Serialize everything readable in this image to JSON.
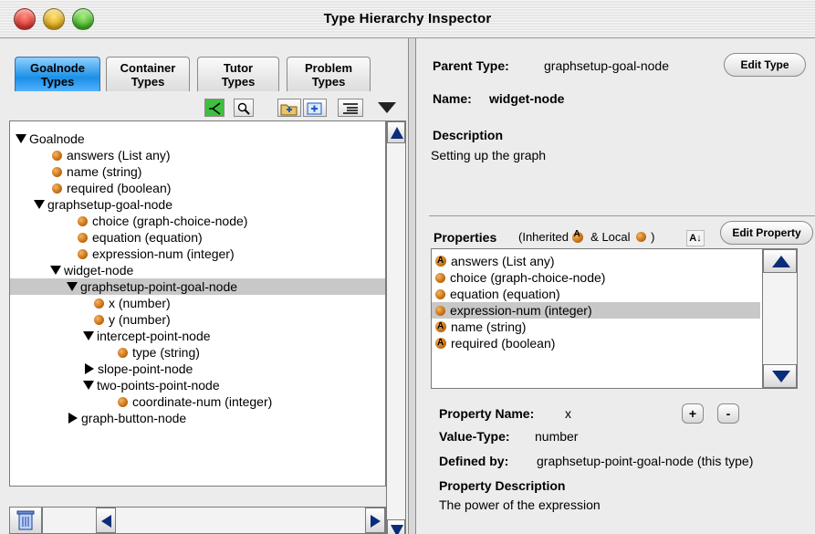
{
  "window": {
    "title": "Type Hierarchy Inspector"
  },
  "tabs": [
    {
      "line1": "Goalnode",
      "line2": "Types",
      "active": true
    },
    {
      "line1": "Container",
      "line2": "Types",
      "active": false
    },
    {
      "line1": "Tutor",
      "line2": "Types",
      "active": false
    },
    {
      "line1": "Problem",
      "line2": "Types",
      "active": false
    }
  ],
  "toolbar": {
    "icons": [
      "tree-branch-icon",
      "magnifier-icon",
      "folder-add-icon",
      "folder-new-icon",
      "list-view-icon",
      "menu-triangle-icon"
    ]
  },
  "tree": [
    {
      "label": "Goalnode",
      "kind": "open"
    },
    {
      "label": "answers (List any)",
      "kind": "leaf"
    },
    {
      "label": "name (string)",
      "kind": "leaf"
    },
    {
      "label": "required (boolean)",
      "kind": "leaf"
    },
    {
      "label": "graphsetup-goal-node",
      "kind": "open"
    },
    {
      "label": "choice (graph-choice-node)",
      "kind": "leaf"
    },
    {
      "label": "equation (equation)",
      "kind": "leaf"
    },
    {
      "label": "expression-num (integer)",
      "kind": "leaf"
    },
    {
      "label": "widget-node",
      "kind": "open"
    },
    {
      "label": "graphsetup-point-goal-node",
      "kind": "open",
      "selected": true
    },
    {
      "label": "x (number)",
      "kind": "leaf"
    },
    {
      "label": "y (number)",
      "kind": "leaf"
    },
    {
      "label": "intercept-point-node",
      "kind": "open"
    },
    {
      "label": "type (string)",
      "kind": "leaf"
    },
    {
      "label": "slope-point-node",
      "kind": "closed"
    },
    {
      "label": "two-points-point-node",
      "kind": "open"
    },
    {
      "label": "coordinate-num (integer)",
      "kind": "leaf"
    },
    {
      "label": "graph-button-node",
      "kind": "closed"
    }
  ],
  "details": {
    "parent_type_label": "Parent Type:",
    "parent_type_value": "graphsetup-goal-node",
    "edit_type_label": "Edit Type",
    "name_label": "Name:",
    "name_value": "widget-node",
    "description_label": "Description",
    "description_value": "Setting up the graph"
  },
  "properties": {
    "label": "Properties",
    "legend_prefix": "(Inherited",
    "legend_mid": "& Local",
    "legend_suffix": ")",
    "sort_label": "A↓",
    "edit_property_label": "Edit Property",
    "items": [
      {
        "label": "answers (List any)",
        "inherited": true
      },
      {
        "label": "choice (graph-choice-node)",
        "inherited": false
      },
      {
        "label": "equation (equation)",
        "inherited": false
      },
      {
        "label": "expression-num (integer)",
        "inherited": false,
        "selected": true
      },
      {
        "label": "name (string)",
        "inherited": true
      },
      {
        "label": "required (boolean)",
        "inherited": true
      }
    ]
  },
  "property_detail": {
    "name_label": "Property Name:",
    "name_value": "x",
    "add_label": "+",
    "remove_label": "-",
    "value_type_label": "Value-Type:",
    "value_type_value": "number",
    "defined_by_label": "Defined by:",
    "defined_by_value": "graphsetup-point-goal-node (this type)",
    "description_label": "Property Description",
    "description_value": "The power of the expression"
  },
  "colors": {
    "accent_tab": "#1c8fe6",
    "scroll_arrow": "#0a2d7a",
    "node_dot": "#c26a0c",
    "selection": "#c8c8c8"
  }
}
